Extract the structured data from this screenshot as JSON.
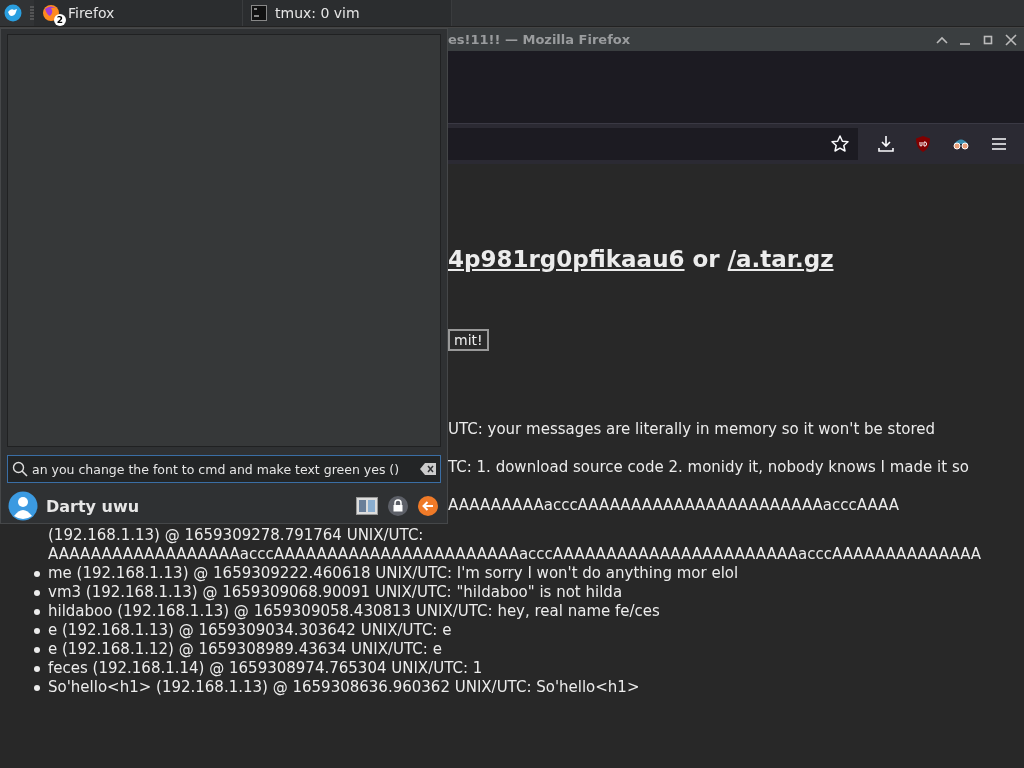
{
  "taskbar": {
    "tasks": [
      {
        "kind": "browser",
        "label": "Firefox",
        "badge": "2"
      },
      {
        "kind": "terminal",
        "label": "tmux: 0 vim"
      }
    ]
  },
  "browser": {
    "title": "es!11!! — Mozilla Firefox",
    "heading": {
      "link_1": "4p981rg0pfikaau6",
      "middle": "or",
      "link_2": "/a.tar.gz"
    },
    "submit_button": "mit!",
    "messages": [
      {
        "kind": "cut",
        "text": "UTC: your messages are literally in memory so it won't be stored"
      },
      {
        "kind": "cut",
        "text": "TC: 1. download source code 2. monidy it, nobody knows I made it so"
      },
      {
        "kind": "cut",
        "text": "AAAAAAAAAacccAAAAAAAAAAAAAAAAAAAAAAAacccAAAA"
      },
      {
        "kind": "continuation",
        "text": "(192.168.1.13) @ 1659309278.791764 UNIX/UTC:"
      },
      {
        "kind": "continuation",
        "text": "AAAAAAAAAAAAAAAAAAacccAAAAAAAAAAAAAAAAAAAAAAAacccAAAAAAAAAAAAAAAAAAAAAAAacccAAAAAAAAAAAAAA"
      },
      {
        "kind": "item",
        "text": "me (192.168.1.13) @ 1659309222.460618 UNIX/UTC: I'm sorry I won't do anything mor elol"
      },
      {
        "kind": "item",
        "text": "vm3 (192.168.1.13) @ 1659309068.90091 UNIX/UTC: \"hildaboo\" is not hilda"
      },
      {
        "kind": "item",
        "text": "hildaboo (192.168.1.13) @ 1659309058.430813 UNIX/UTC: hey, real name fe/ces"
      },
      {
        "kind": "item",
        "text": "e (192.168.1.13) @ 1659309034.303642 UNIX/UTC: e"
      },
      {
        "kind": "item",
        "text": "e (192.168.1.12) @ 1659308989.43634 UNIX/UTC: e"
      },
      {
        "kind": "item",
        "text": "feces (192.168.1.14) @ 1659308974.765304 UNIX/UTC: 1"
      },
      {
        "kind": "item",
        "text": "So'hello<h1> (192.168.1.13) @ 1659308636.960362 UNIX/UTC: So'hello<h1>"
      }
    ]
  },
  "launcher": {
    "search": {
      "value": "an you change the font to cmd and make text green yes ()"
    },
    "user": "Darty uwu"
  }
}
